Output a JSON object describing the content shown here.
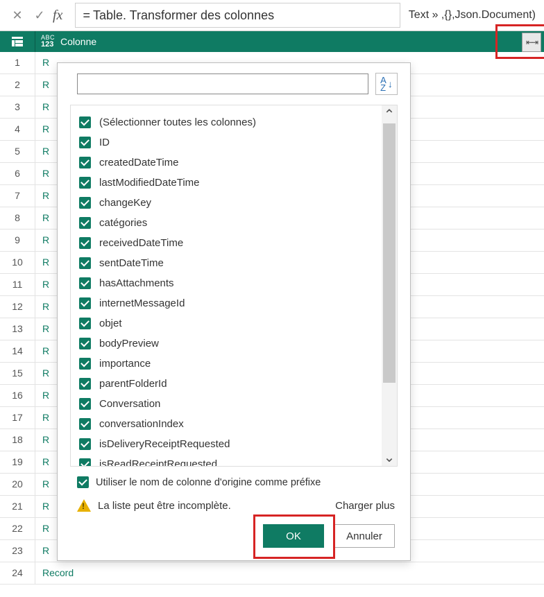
{
  "formula_bar": {
    "fx_label": "fx",
    "formula_prefix": "= ",
    "formula_text": "Table. Transformer des colonnes",
    "formula_suffix": "Text » ,{},Json.Document)"
  },
  "column_header": {
    "type_line1": "ABC",
    "type_line2": "123",
    "name": "Colonne"
  },
  "rows": [
    {
      "num": "1",
      "value": "R"
    },
    {
      "num": "2",
      "value": "R"
    },
    {
      "num": "3",
      "value": "R"
    },
    {
      "num": "4",
      "value": "R"
    },
    {
      "num": "5",
      "value": "R"
    },
    {
      "num": "6",
      "value": "R"
    },
    {
      "num": "7",
      "value": "R"
    },
    {
      "num": "8",
      "value": "R"
    },
    {
      "num": "9",
      "value": "R"
    },
    {
      "num": "10",
      "value": "R"
    },
    {
      "num": "11",
      "value": "R"
    },
    {
      "num": "12",
      "value": "R"
    },
    {
      "num": "13",
      "value": "R"
    },
    {
      "num": "14",
      "value": "R"
    },
    {
      "num": "15",
      "value": "R"
    },
    {
      "num": "16",
      "value": "R"
    },
    {
      "num": "17",
      "value": "R"
    },
    {
      "num": "18",
      "value": "R"
    },
    {
      "num": "19",
      "value": "R"
    },
    {
      "num": "20",
      "value": "R"
    },
    {
      "num": "21",
      "value": "R"
    },
    {
      "num": "22",
      "value": "R"
    },
    {
      "num": "23",
      "value": "R"
    },
    {
      "num": "24",
      "value": "Record"
    }
  ],
  "popup": {
    "search_placeholder": "",
    "sort_label": "A\nZ",
    "columns": [
      "(Sélectionner toutes les colonnes)",
      "ID",
      "createdDateTime",
      "lastModifiedDateTime",
      "changeKey",
      "catégories",
      "receivedDateTime",
      "sentDateTime",
      "hasAttachments",
      "internetMessageId",
      "objet",
      "bodyPreview",
      "importance",
      "parentFolderId",
      "Conversation",
      "conversationIndex",
      "isDeliveryReceiptRequested",
      "isReadReceiptRequested"
    ],
    "prefix_label": "Utiliser le nom de colonne d'origine comme préfixe",
    "warning_text": "La liste peut être incomplète.",
    "load_more": "Charger plus",
    "ok_label": "OK",
    "cancel_label": "Annuler"
  }
}
